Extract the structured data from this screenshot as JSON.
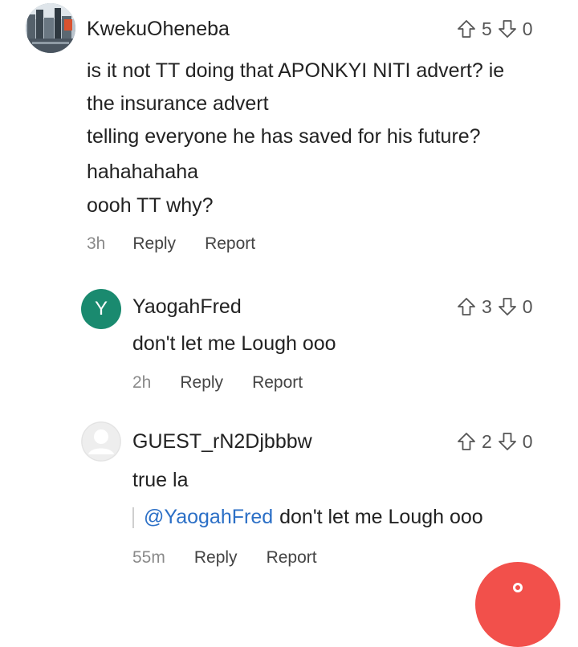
{
  "comments": [
    {
      "username": "KwekuOheneba",
      "upvotes": "5",
      "downvotes": "0",
      "lines": [
        "is it not TT doing that APONKYI NITI advert? ie",
        "the insurance advert",
        "telling everyone he has saved for his future?",
        "hahahahaha",
        "oooh TT why?"
      ],
      "time": "3h",
      "reply_label": "Reply",
      "report_label": "Report"
    },
    {
      "username": "YaogahFred",
      "avatar_letter": "Y",
      "avatar_color": "#1a8a6f",
      "upvotes": "3",
      "downvotes": "0",
      "lines": [
        "don't let me Lough ooo"
      ],
      "time": "2h",
      "reply_label": "Reply",
      "report_label": "Report"
    },
    {
      "username": "GUEST_rN2Djbbbw",
      "upvotes": "2",
      "downvotes": "0",
      "lines": [
        "true la"
      ],
      "quote_mention": "@YaogahFred",
      "quote_text": "don't let me Lough ooo",
      "time": "55m",
      "reply_label": "Reply",
      "report_label": "Report"
    }
  ],
  "colors": {
    "mention": "#2b6fc6",
    "fab": "#f2504b"
  },
  "icons": {
    "upvote": "arrow-up-outline-icon",
    "downvote": "arrow-down-outline-icon",
    "fab": "compose-icon"
  }
}
